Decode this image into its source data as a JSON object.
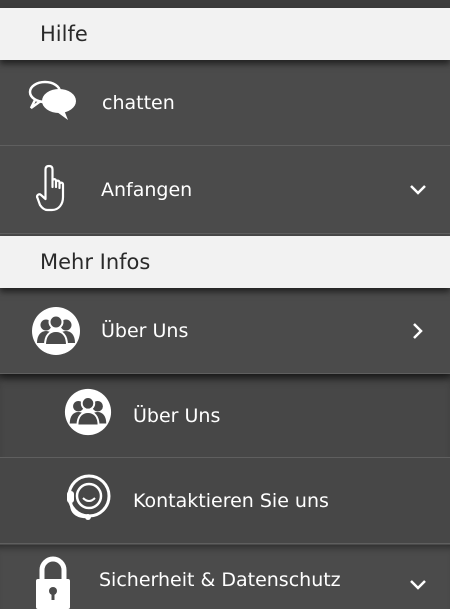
{
  "sections": {
    "help": {
      "title": "Hilfe"
    },
    "more": {
      "title": "Mehr Infos"
    }
  },
  "items": {
    "chat": {
      "label": "chatten",
      "icon": "chat-bubbles-icon"
    },
    "start": {
      "label": "Anfangen",
      "icon": "hand-pointer-icon",
      "chevron": "chevron-down-icon"
    },
    "about": {
      "label": "Über Uns",
      "icon": "people-circle-icon",
      "chevron": "chevron-right-icon"
    },
    "about_sub": {
      "label": "Über Uns",
      "icon": "people-circle-icon"
    },
    "contact": {
      "label": "Kontaktieren Sie uns",
      "icon": "headset-icon"
    },
    "security": {
      "label": "Sicherheit & Datenschutz",
      "icon": "padlock-icon",
      "chevron": "chevron-down-icon"
    }
  },
  "colors": {
    "menu_background": "#4b4b4b",
    "section_header_background": "#f2f2f2",
    "section_header_text": "#2a2a2a",
    "item_text": "#ffffff"
  }
}
